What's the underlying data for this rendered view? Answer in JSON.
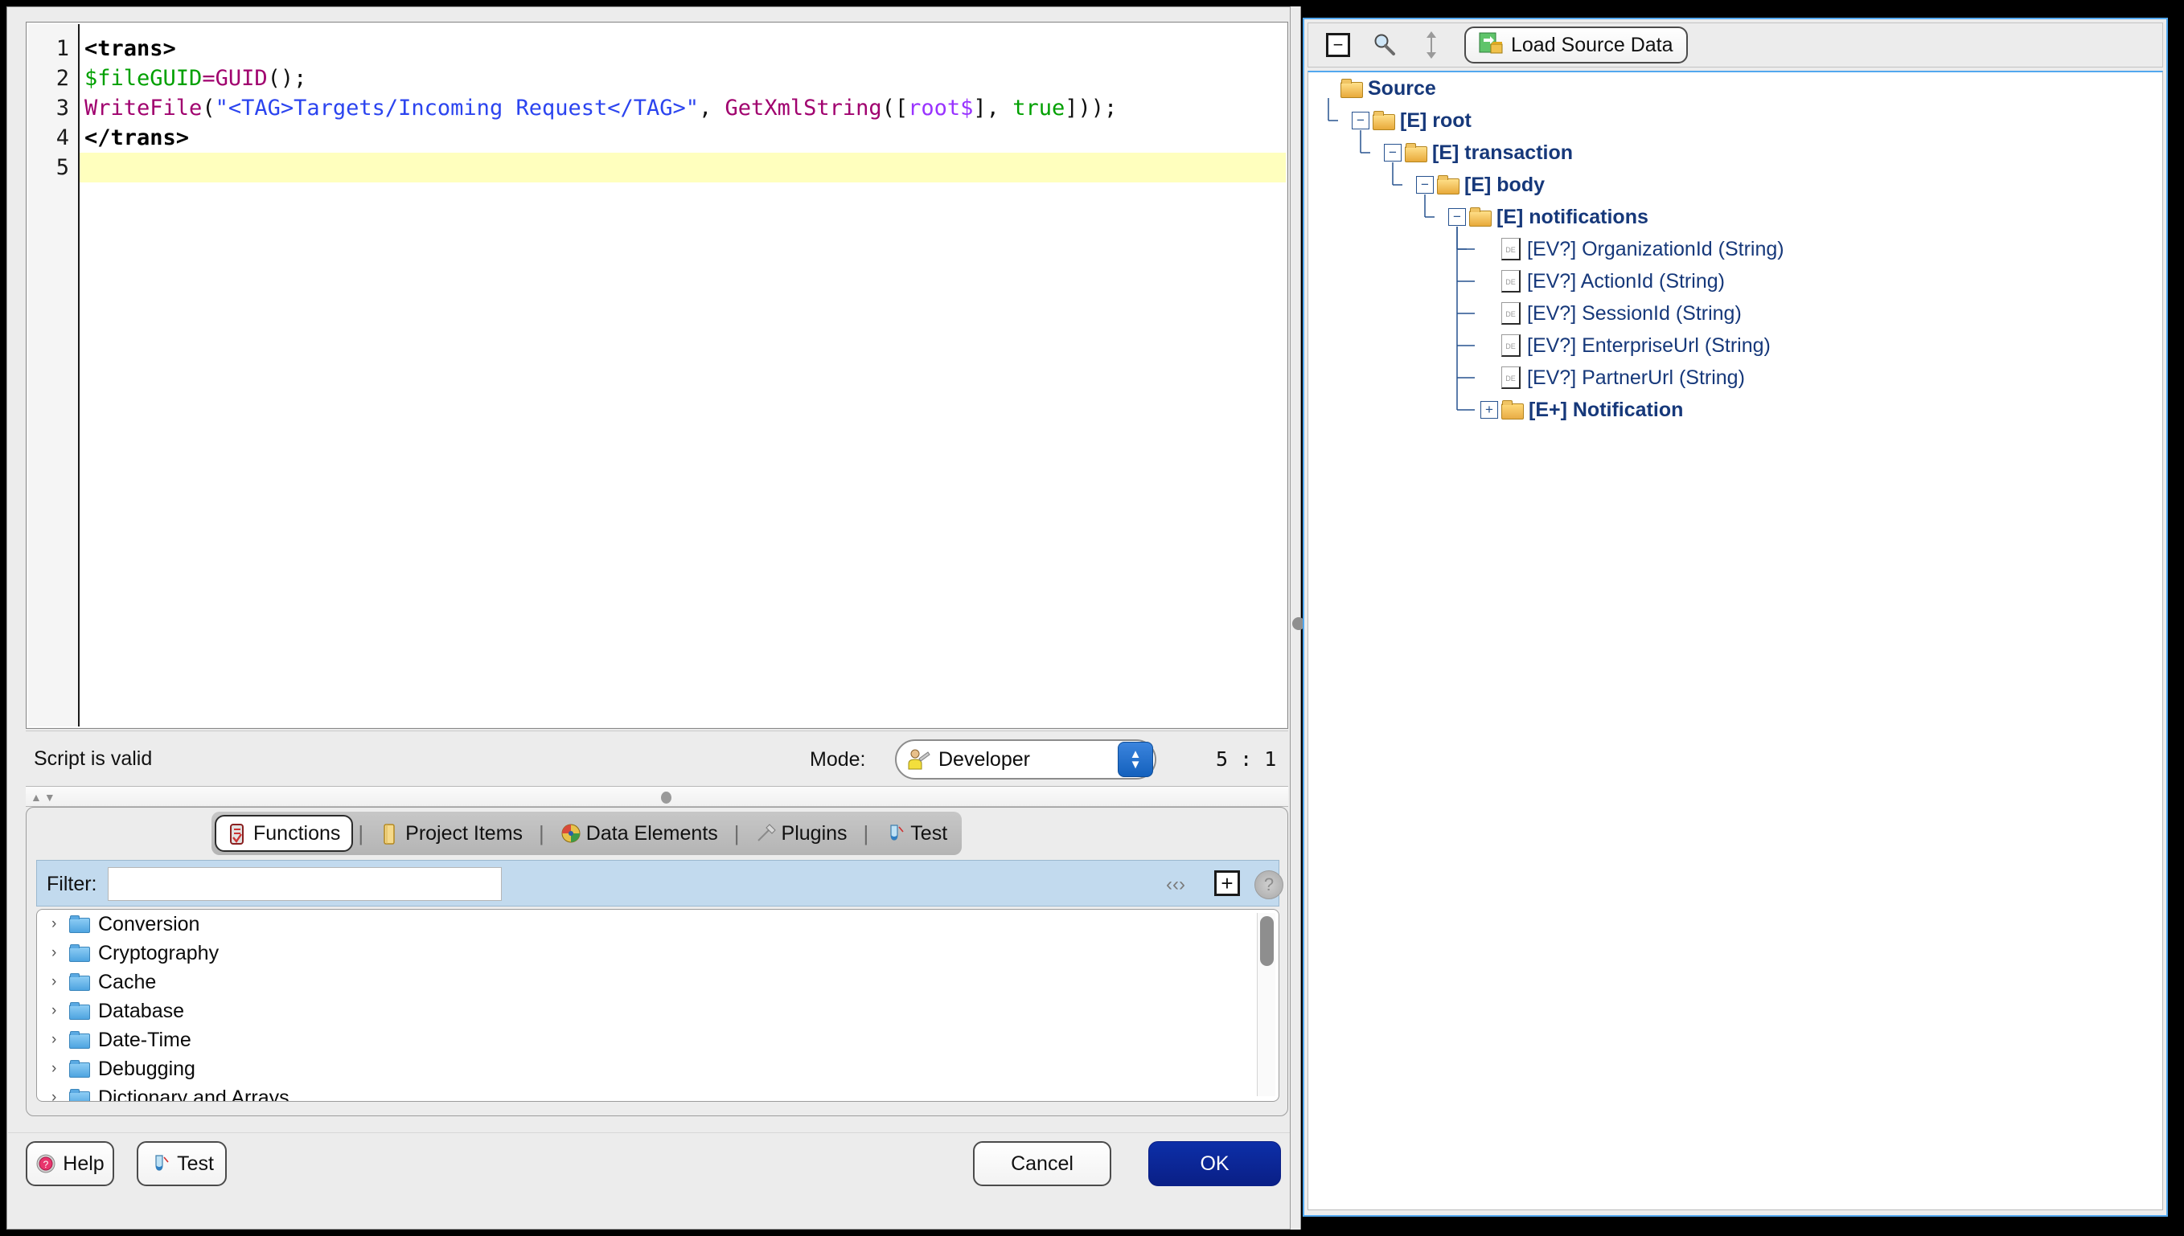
{
  "editor": {
    "lines": [
      {
        "n": "1",
        "current": false,
        "tokens": [
          {
            "t": "<trans>",
            "c": "tok-tag"
          }
        ]
      },
      {
        "n": "2",
        "current": false,
        "tokens": [
          {
            "t": "$fileGUID",
            "c": "tok-var"
          },
          {
            "t": "=",
            "c": "tok-func"
          },
          {
            "t": "GUID",
            "c": "tok-func"
          },
          {
            "t": "();",
            "c": "tok-punct"
          }
        ]
      },
      {
        "n": "3",
        "current": false,
        "tokens": [
          {
            "t": "WriteFile",
            "c": "tok-func"
          },
          {
            "t": "(",
            "c": "tok-punct"
          },
          {
            "t": "\"<TAG>Targets/Incoming Request</TAG>\"",
            "c": "tok-string"
          },
          {
            "t": ", ",
            "c": "tok-punct"
          },
          {
            "t": "GetXmlString",
            "c": "tok-func"
          },
          {
            "t": "([",
            "c": "tok-punct"
          },
          {
            "t": "root$",
            "c": "tok-de"
          },
          {
            "t": "], ",
            "c": "tok-punct"
          },
          {
            "t": "true",
            "c": "tok-bool"
          },
          {
            "t": "]));",
            "c": "tok-punct"
          }
        ]
      },
      {
        "n": "4",
        "current": false,
        "tokens": [
          {
            "t": "</trans>",
            "c": "tok-tag"
          }
        ]
      },
      {
        "n": "5",
        "current": true,
        "tokens": []
      }
    ]
  },
  "status": {
    "message": "Script is valid",
    "mode_label": "Mode:",
    "mode_value": "Developer",
    "mode_icon": "developer-person-icon",
    "caret_position": "5 : 1"
  },
  "tabs": [
    {
      "label": "Functions",
      "icon": "functions-icon",
      "active": true
    },
    {
      "label": "Project Items",
      "icon": "project-items-icon",
      "active": false
    },
    {
      "label": "Data Elements",
      "icon": "data-elements-icon",
      "active": false
    },
    {
      "label": "Plugins",
      "icon": "plugins-icon",
      "active": false
    },
    {
      "label": "Test",
      "icon": "test-icon",
      "active": false
    }
  ],
  "filter": {
    "label": "Filter:",
    "value": "",
    "placeholder": "",
    "icons": [
      {
        "name": "navigate-icon",
        "glyph": "‹‸›"
      },
      {
        "name": "add-icon",
        "glyph": "+"
      },
      {
        "name": "help-round-icon",
        "glyph": "?"
      }
    ]
  },
  "functions_list": [
    {
      "label": "Conversion"
    },
    {
      "label": "Cryptography"
    },
    {
      "label": "Cache"
    },
    {
      "label": "Database"
    },
    {
      "label": "Date-Time"
    },
    {
      "label": "Debugging"
    },
    {
      "label": "Dictionary and Arrays"
    }
  ],
  "dialog_buttons": {
    "help": "Help",
    "test": "Test",
    "cancel": "Cancel",
    "ok": "OK"
  },
  "right_panel": {
    "toolbar": {
      "collapse_glyph": "−",
      "search_icon": "magnifier-icon",
      "expand_icon": "expand-collapse-icon",
      "load_button": "Load Source Data",
      "load_icon": "load-source-data-icon"
    },
    "tree": [
      {
        "label": "Source",
        "depth": 0,
        "kind": "folder-open",
        "bold": true,
        "expander": "none"
      },
      {
        "label": "[E] root",
        "depth": 1,
        "kind": "folder-open",
        "bold": true,
        "expander": "minus"
      },
      {
        "label": "[E] transaction",
        "depth": 2,
        "kind": "folder-open",
        "bold": true,
        "expander": "minus"
      },
      {
        "label": "[E] body",
        "depth": 3,
        "kind": "folder-open",
        "bold": true,
        "expander": "minus"
      },
      {
        "label": "[E] notifications",
        "depth": 4,
        "kind": "folder-open",
        "bold": true,
        "expander": "minus"
      },
      {
        "label": "[EV?] OrganizationId  (String)",
        "depth": 5,
        "kind": "de",
        "bold": false,
        "expander": "none"
      },
      {
        "label": "[EV?] ActionId  (String)",
        "depth": 5,
        "kind": "de",
        "bold": false,
        "expander": "none"
      },
      {
        "label": "[EV?] SessionId  (String)",
        "depth": 5,
        "kind": "de",
        "bold": false,
        "expander": "none"
      },
      {
        "label": "[EV?] EnterpriseUrl  (String)",
        "depth": 5,
        "kind": "de",
        "bold": false,
        "expander": "none"
      },
      {
        "label": "[EV?] PartnerUrl  (String)",
        "depth": 5,
        "kind": "de",
        "bold": false,
        "expander": "none"
      },
      {
        "label": "[E+] Notification",
        "depth": 5,
        "kind": "folder-closed",
        "bold": true,
        "expander": "plus"
      }
    ]
  },
  "colors": {
    "accent_blue": "#53a8ef",
    "ok_button": "#0a1f86",
    "tree_text": "#16387a",
    "current_line": "#ffffbe",
    "filter_bar": "#c2daee"
  }
}
